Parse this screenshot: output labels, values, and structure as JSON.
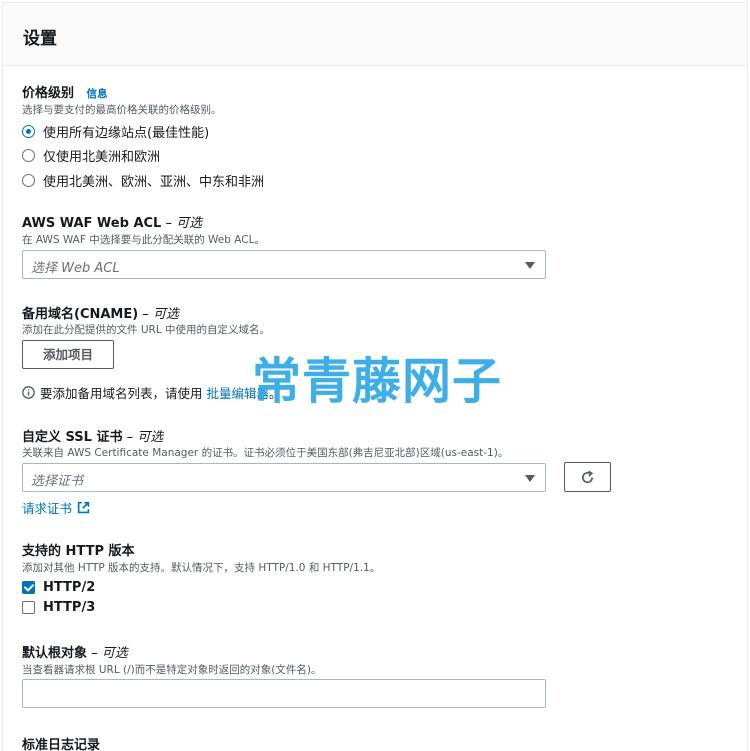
{
  "settings": {
    "title": "设置"
  },
  "price_class": {
    "label": "价格级别",
    "info": "信息",
    "description": "选择与要支付的最高价格关联的价格级别。",
    "options": [
      {
        "label": "使用所有边缘站点(最佳性能)",
        "selected": true
      },
      {
        "label": "仅使用北美洲和欧洲",
        "selected": false
      },
      {
        "label": "使用北美洲、欧洲、亚洲、中东和非洲",
        "selected": false
      }
    ]
  },
  "waf": {
    "label": "AWS WAF Web ACL",
    "optional": " – 可选",
    "description": "在 AWS WAF 中选择要与此分配关联的 Web ACL。",
    "placeholder": "选择 Web ACL"
  },
  "cname": {
    "label": "备用域名(CNAME)",
    "optional": " – 可选",
    "description": "添加在此分配提供的文件 URL 中使用的自定义域名。",
    "add_button": "添加项目",
    "info_text": "要添加备用域名列表，请使用",
    "info_link": "批量编辑器",
    "info_suffix": "。"
  },
  "ssl": {
    "label": "自定义 SSL 证书",
    "optional": " – 可选",
    "description": "关联来自 AWS Certificate Manager 的证书。证书必须位于美国东部(弗吉尼亚北部)区域(us-east-1)。",
    "placeholder": "选择证书",
    "request_link": "请求证书"
  },
  "http": {
    "label": "支持的 HTTP 版本",
    "description": "添加对其他 HTTP 版本的支持。默认情况下，支持 HTTP/1.0 和 HTTP/1.1。",
    "options": [
      {
        "label": "HTTP/2",
        "checked": true
      },
      {
        "label": "HTTP/3",
        "checked": false
      }
    ]
  },
  "root_object": {
    "label": "默认根对象",
    "optional": " – 可选",
    "description": "当查看器请求根 URL (/)而不是特定对象时返回的对象(文件名)。",
    "value": ""
  },
  "logging": {
    "label": "标准日志记录"
  },
  "watermark": "常青藤网子",
  "colors": {
    "accent": "#0073bb",
    "watermark": "#2ea8e8"
  }
}
